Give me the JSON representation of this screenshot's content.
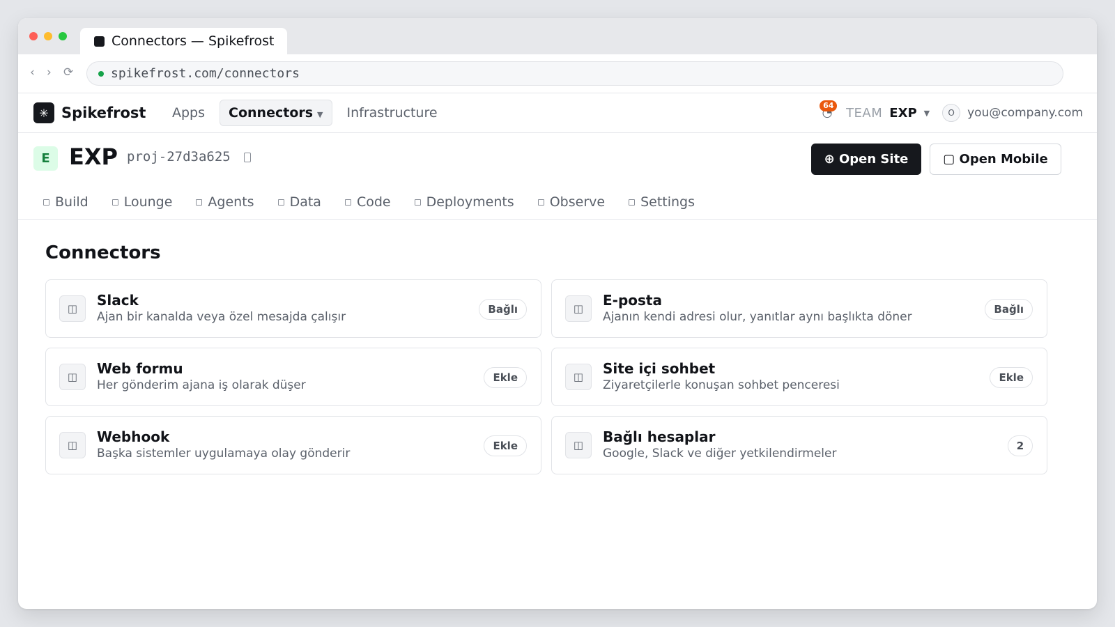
{
  "browser": {
    "tab_title": "Connectors — Spikefrost",
    "url": "spikefrost.com/connectors"
  },
  "app": {
    "brand": "Spikefrost",
    "nav": [
      {
        "label": "Apps"
      },
      {
        "label": "Connectors"
      },
      {
        "label": "Infrastructure"
      }
    ],
    "notification_count": "64",
    "team_label": "TEAM",
    "team_name": "EXP",
    "avatar_letter": "O",
    "email": "you@company.com"
  },
  "project": {
    "badge_letter": "E",
    "name": "EXP",
    "id": "proj-27d3a625",
    "open_site_label": "⊕ Open Site",
    "open_mobile_label": "▢ Open Mobile"
  },
  "subnav": [
    {
      "label": "Build"
    },
    {
      "label": "Lounge"
    },
    {
      "label": "Agents"
    },
    {
      "label": "Data"
    },
    {
      "label": "Code"
    },
    {
      "label": "Deployments"
    },
    {
      "label": "Observe"
    },
    {
      "label": "Settings"
    }
  ],
  "page": {
    "title": "Connectors",
    "cards": [
      {
        "title": "Slack",
        "desc": "Ajan bir kanalda veya özel mesajda çalışır",
        "pill": "Bağlı"
      },
      {
        "title": "E-posta",
        "desc": "Ajanın kendi adresi olur, yanıtlar aynı başlıkta döner",
        "pill": "Bağlı"
      },
      {
        "title": "Web formu",
        "desc": "Her gönderim ajana iş olarak düşer",
        "pill": "Ekle"
      },
      {
        "title": "Site içi sohbet",
        "desc": "Ziyaretçilerle konuşan sohbet penceresi",
        "pill": "Ekle"
      },
      {
        "title": "Webhook",
        "desc": "Başka sistemler uygulamaya olay gönderir",
        "pill": "Ekle"
      },
      {
        "title": "Bağlı hesaplar",
        "desc": "Google, Slack ve diğer yetkilendirmeler",
        "pill": "2"
      }
    ]
  },
  "colors": {
    "primary_button": "#16181d",
    "project_badge_bg": "#dcfce7",
    "project_badge_fg": "#15803d",
    "notification_badge": "#ea580c",
    "secure_dot": "#16a34a"
  }
}
